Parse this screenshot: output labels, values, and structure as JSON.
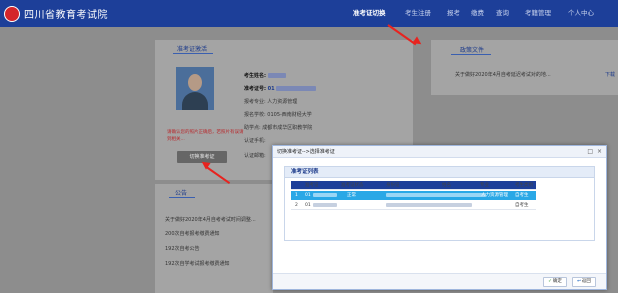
{
  "header": {
    "logo_text": "四川省教育考试院",
    "nav": [
      {
        "label": "准考证切换",
        "active": true
      },
      {
        "label": "考生注册",
        "active": false
      },
      {
        "label": "报考",
        "active": false
      },
      {
        "label": "缴费",
        "active": false
      },
      {
        "label": "查询",
        "active": false
      },
      {
        "label": "考籍管理",
        "active": false
      },
      {
        "label": "个人中心",
        "active": false
      }
    ]
  },
  "ticket_panel": {
    "title": "准考证激活",
    "rows": [
      {
        "label": "考生姓名:",
        "value": ""
      },
      {
        "label": "准考证号:",
        "value": "01"
      },
      {
        "label": "报考专业:",
        "value": "人力资源管理"
      },
      {
        "label": "报名学校:",
        "value": "0105-西南财经大学"
      },
      {
        "label": "助学点:",
        "value": "成都市成华区职教学院"
      },
      {
        "label": "认证手机:",
        "value": ""
      },
      {
        "label": "认证邮箱:",
        "value": ""
      }
    ],
    "warning": "请确认您的照片正确后，若照片有误请到相关...",
    "switch_button": "切换准考证"
  },
  "policy_panel": {
    "title": "政策文件",
    "item": "关于做好2020年4月自考延迟考试对的地...",
    "more": "下载"
  },
  "notice_panel": {
    "title": "公告",
    "items": [
      "关于做好2020年4月自考考试时间调整...",
      "200次自考报考缴费通知",
      "192次自考公告",
      "192次自学考试报考缴费通知"
    ]
  },
  "modal": {
    "title": "切换准考证-->选择准考证",
    "close_icon": "×",
    "max_icon": "□",
    "list_title": "准考证列表",
    "columns": [
      "准考证",
      "准考证状态",
      "身份证",
      "姓名",
      "专业",
      "考生类别"
    ],
    "rows": [
      {
        "index": "1",
        "ticket": "01",
        "status": "正常",
        "id_card": "",
        "name": "",
        "major": "人力资源管理",
        "category": "自考生",
        "selected": true
      },
      {
        "index": "2",
        "ticket": "01",
        "status": "",
        "id_card": "",
        "name": "",
        "major": "",
        "category": "自考生",
        "selected": false
      }
    ],
    "ok_label": "确定",
    "back_label": "返回"
  }
}
